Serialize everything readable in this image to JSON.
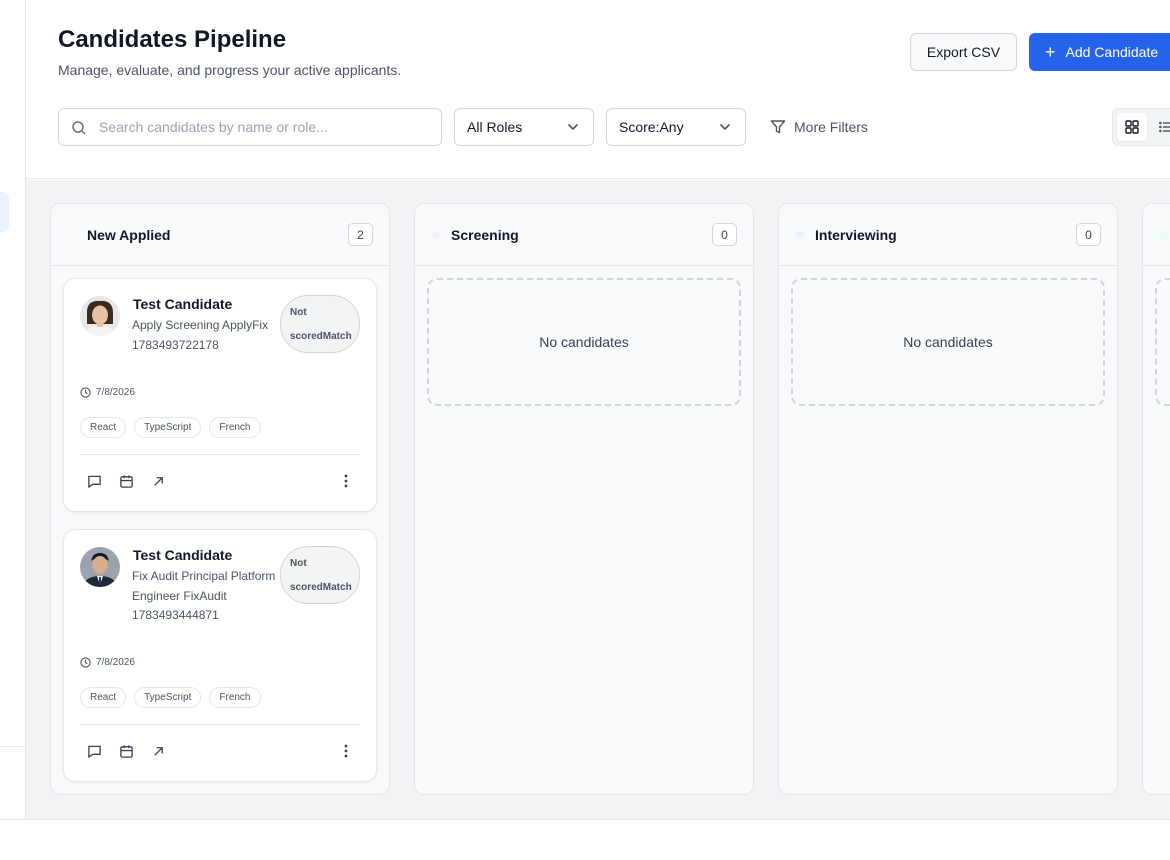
{
  "header": {
    "title": "Candidates Pipeline",
    "subtitle": "Manage, evaluate, and progress your active applicants.",
    "export_label": "Export CSV",
    "add_label": "Add Candidate"
  },
  "filters": {
    "search_placeholder": "Search candidates by name or role...",
    "search_value": "",
    "roles_selected": "All Roles",
    "score_selected": "Score:Any",
    "more_filters_label": "More Filters"
  },
  "columns": [
    {
      "title": "New Applied",
      "count": "2",
      "dot_color": "#f9fafb"
    },
    {
      "title": "Screening",
      "count": "0",
      "dot_color": "#eef2ff",
      "empty_text": "No candidates"
    },
    {
      "title": "Interviewing",
      "count": "0",
      "dot_color": "#eef2ff",
      "empty_text": "No candidates"
    },
    {
      "title": "",
      "count": "",
      "dot_color": "#ecfdf5"
    }
  ],
  "cards": [
    {
      "name": "Test Candidate",
      "role": "Apply Screening ApplyFix 1783493722178",
      "score_badge": "Not scoredMatch",
      "date": "7/8/2026",
      "tags": [
        "React",
        "TypeScript",
        "French"
      ]
    },
    {
      "name": "Test Candidate",
      "role": "Fix Audit Principal Platform Engineer FixAudit 1783493444871",
      "score_badge": "Not scoredMatch",
      "date": "7/8/2026",
      "tags": [
        "React",
        "TypeScript",
        "French"
      ]
    }
  ],
  "colors": {
    "primary": "#2563eb",
    "border": "#e5e7eb",
    "text": "#111827",
    "muted": "#4b5563"
  }
}
